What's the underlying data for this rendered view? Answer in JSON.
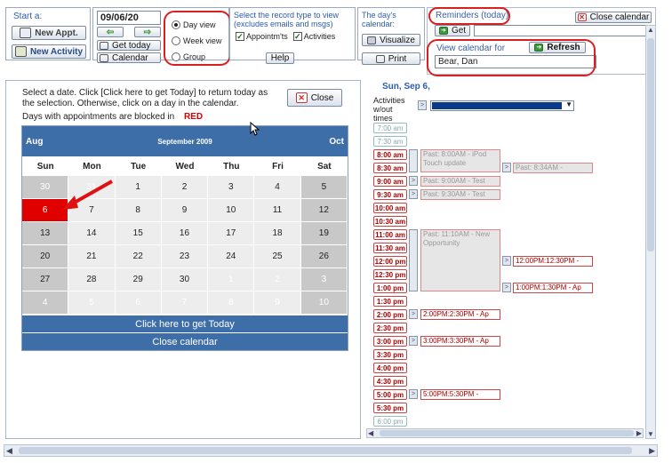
{
  "toolbar": {
    "start_label": "Start a:",
    "new_appt": "New Appt.",
    "new_activity": "New Activity",
    "date_value": "09/06/20",
    "get_today": "Get today",
    "calendar": "Calendar",
    "views": [
      "Day view",
      "Week view",
      "Group"
    ],
    "record_type_label": "Select the record type to view (excludes emails and msgs)",
    "chk_appts": "Appointm'ts",
    "chk_activities": "Activities",
    "help": "Help",
    "days_calendar_label": "The day's calendar:",
    "visualize": "Visualize",
    "print": "Print",
    "reminders": "Reminders (today)",
    "get": "Get",
    "close_calendar": "Close calendar",
    "view_calendar_for": "View calendar for",
    "refresh": "Refresh",
    "user": "Bear, Dan"
  },
  "calendar_panel": {
    "instructions": "Select a date. Click [Click here to get Today] to return today as the selection. Otherwise, click on a day in the calendar.",
    "blocked_note": "Days with appointments are blocked in",
    "blocked_color_word": "RED",
    "close": "Close",
    "prev_month": "Aug",
    "month_title": "September 2009",
    "next_month": "Oct",
    "day_names": [
      "Sun",
      "Mon",
      "Tue",
      "Wed",
      "Thu",
      "Fri",
      "Sat"
    ],
    "weeks": [
      [
        "30",
        "31",
        "1",
        "2",
        "3",
        "4",
        "5"
      ],
      [
        "6",
        "7",
        "8",
        "9",
        "10",
        "11",
        "12"
      ],
      [
        "13",
        "14",
        "15",
        "16",
        "17",
        "18",
        "19"
      ],
      [
        "20",
        "21",
        "22",
        "23",
        "24",
        "25",
        "26"
      ],
      [
        "27",
        "28",
        "29",
        "30",
        "1",
        "2",
        "3"
      ],
      [
        "4",
        "5",
        "6",
        "7",
        "8",
        "9",
        "10"
      ]
    ],
    "get_today_bar": "Click here to get Today",
    "close_bar": "Close calendar"
  },
  "day_view": {
    "date_title": "Sun, Sep 6,",
    "activities_label": "Activities w/out times",
    "slots": [
      "7:00 am",
      "7:30 am",
      "8:00 am",
      "8:30 am",
      "9:00 am",
      "9:30 am",
      "10:00 am",
      "10:30 am",
      "11:00 am",
      "11:30 am",
      "12:00 pm",
      "12:30 pm",
      "1:00 pm",
      "1:30 pm",
      "2:00 pm",
      "2:30 pm",
      "3:00 pm",
      "3:30 pm",
      "4:00 pm",
      "4:30 pm",
      "5:00 pm",
      "5:30 pm",
      "6:00 pm"
    ],
    "appts": {
      "a1": "Past: 8:00AM - iPod Touch update",
      "a2": "Past: 8:34AM -",
      "a3": "Past: 9:00AM - Test",
      "a4": "Past: 9:30AM - Test",
      "a5": "Past: 11:10AM - New Opportunity",
      "a6": "12:00PM:12:30PM -",
      "a7": "1:00PM:1:30PM - Ap",
      "a8": "2:00PM:2:30PM - Ap",
      "a9": "3:00PM:3:30PM - Ap",
      "a10": "5:00PM:5:30PM -"
    }
  }
}
